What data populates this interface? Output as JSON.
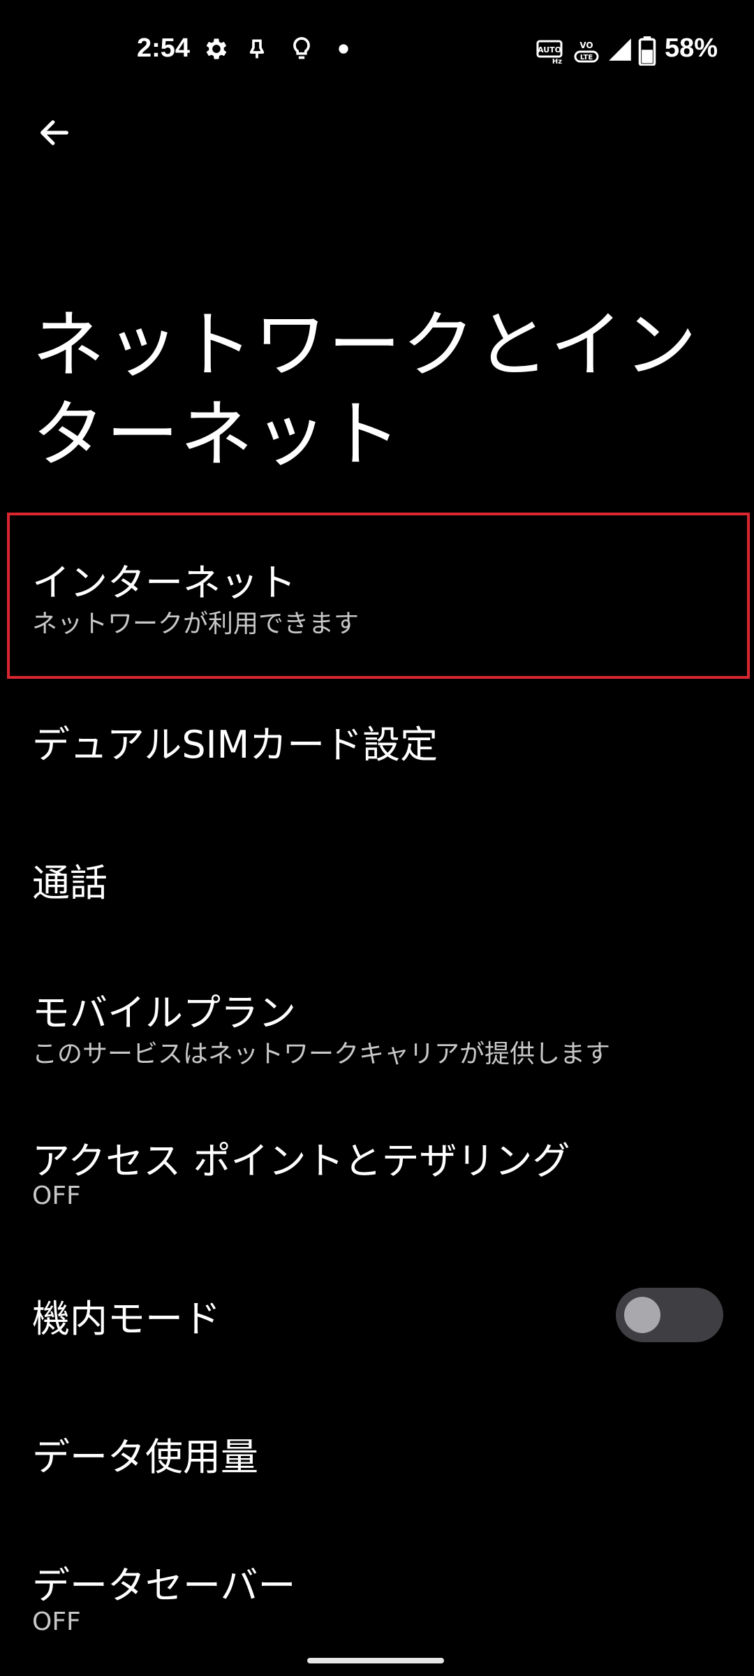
{
  "status_bar": {
    "time": "2:54",
    "battery_percent": "58%",
    "icons": [
      "gear-icon",
      "notification-bell-icon",
      "lightbulb-icon",
      "dot-icon",
      "auto-hz-icon",
      "volte-icon",
      "signal-icon",
      "battery-icon"
    ],
    "auto_badge": "AUTO",
    "hz_badge": "Hz",
    "vo_badge": "VO",
    "lte_badge": "LTE"
  },
  "header": {
    "back_icon": "arrow-back-icon",
    "title": "ネットワークとインターネット"
  },
  "settings": [
    {
      "title": "インターネット",
      "summary": "ネットワークが利用できます",
      "highlighted": true
    },
    {
      "title": "デュアルSIMカード設定",
      "summary": ""
    },
    {
      "title": "通話",
      "summary": ""
    },
    {
      "title": "モバイルプラン",
      "summary": "このサービスはネットワークキャリアが提供します"
    },
    {
      "title": "アクセス ポイントとテザリング",
      "summary": "OFF"
    },
    {
      "title": "機内モード",
      "summary": "",
      "toggle": false
    },
    {
      "title": "データ使用量",
      "summary": ""
    },
    {
      "title": "データセーバー",
      "summary": "OFF"
    }
  ],
  "colors": {
    "background": "#000000",
    "text_primary": "#ffffff",
    "text_secondary": "#c8c8c8",
    "highlight_border": "#d9262f",
    "toggle_track": "#3f3f43",
    "toggle_thumb": "#a9a9ad"
  }
}
